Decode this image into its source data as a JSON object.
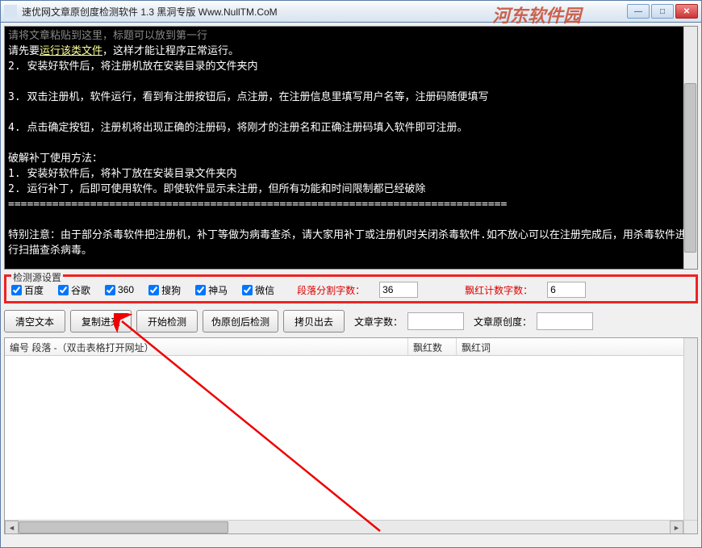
{
  "window": {
    "title": "速优网文章原创度检测软件 1.3   黑洞专版  Www.NullTM.CoM",
    "watermark": "河东软件园"
  },
  "textarea": {
    "placeholder": "请将文章粘贴到这里，标题可以放到第一行",
    "highlight_prefix": "请先要",
    "highlight_link": "运行该类文件",
    "highlight_suffix": "，这样才能让程序正常运行。",
    "body": "\n2. 安装好软件后，将注册机放在安装目录的文件夹内\n\n3. 双击注册机，软件运行，看到有注册按钮后，点注册，在注册信息里填写用户名等，注册码随便填写\n\n4. 点击确定按钮，注册机将出现正确的注册码，将刚才的注册名和正确注册码填入软件即可注册。\n\n破解补丁使用方法：\n1. 安装好软件后，将补丁放在安装目录文件夹内\n2. 运行补丁，后即可使用软件。即使软件显示未注册，但所有功能和时间限制都已经破除\n===============================================================================\n\n特别注意：由于部分杀毒软件把注册机，补丁等做为病毒查杀，请大家用补丁或注册机时关闭杀毒软件.如不放心可以在注册完成后，用杀毒软件进行扫描查杀病毒。"
  },
  "fieldset": {
    "legend": "检测源设置",
    "sources": [
      "百度",
      "谷歌",
      "360",
      "搜狗",
      "神马",
      "微信"
    ],
    "para_split_label": "段落分割字数：",
    "para_split_value": "36",
    "red_count_label": "飘红计数字数：",
    "red_count_value": "6"
  },
  "buttons": {
    "clear": "清空文本",
    "copy_in": "复制进来",
    "start": "开始检测",
    "pseudo": "伪原创后检测",
    "copy_out": "拷贝出去"
  },
  "info": {
    "word_count_label": "文章字数：",
    "word_count_value": "",
    "originality_label": "文章原创度：",
    "originality_value": ""
  },
  "table": {
    "col1": "编号  段落 -（双击表格打开网址）",
    "col2": "飘红数",
    "col3": "飘红词"
  }
}
